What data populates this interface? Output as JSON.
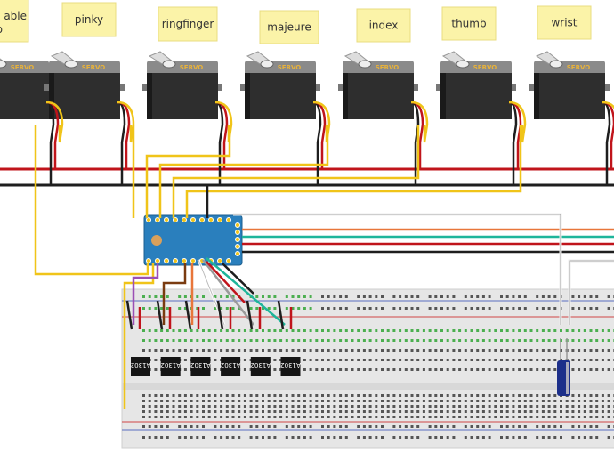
{
  "labels": [
    {
      "text": "able",
      "text2": "b"
    },
    {
      "text": "pinky"
    },
    {
      "text": "ringfinger"
    },
    {
      "text": "majeure"
    },
    {
      "text": "index"
    },
    {
      "text": "thumb"
    },
    {
      "text": "wrist"
    }
  ],
  "servo_text": "SERVO",
  "chip_text": "A1302",
  "chip_count": 6,
  "colors": {
    "label_bg": "#fbf3a8",
    "servo_body": "#2e2e2e",
    "servo_top": "#8a8a8a",
    "arduino": "#2a7fbd",
    "breadboard": "#e6e6e6",
    "wire_red": "#c0141b",
    "wire_black": "#1e1e1e",
    "wire_yellow": "#f0c419",
    "wire_orange": "#e8763a",
    "wire_teal": "#1fb59a",
    "wire_purple": "#9b4fb5",
    "wire_brown": "#7a3b10",
    "wire_gray": "#9a9a9a"
  }
}
